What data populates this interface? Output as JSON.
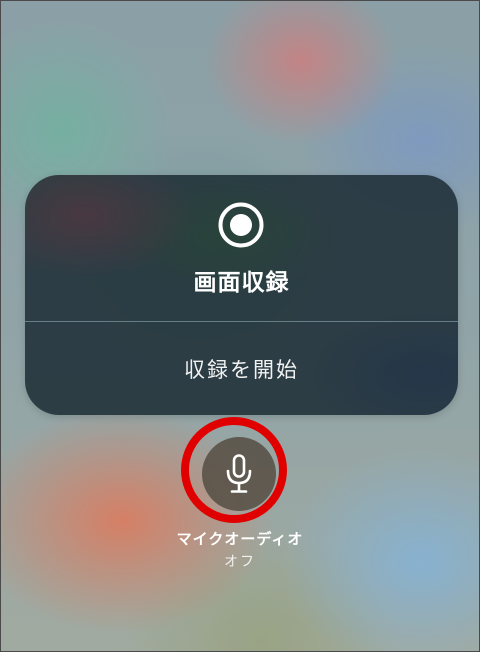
{
  "screen_recording": {
    "title": "画面収録",
    "record_icon": "record-icon",
    "start_button_label": "収録を開始"
  },
  "microphone": {
    "icon": "microphone-icon",
    "label": "マイクオーディオ",
    "status": "オフ"
  },
  "colors": {
    "highlight_ring": "#e00000",
    "panel_bg": "#1c2c34",
    "mic_button_bg": "#585046",
    "text": "#ffffff"
  }
}
